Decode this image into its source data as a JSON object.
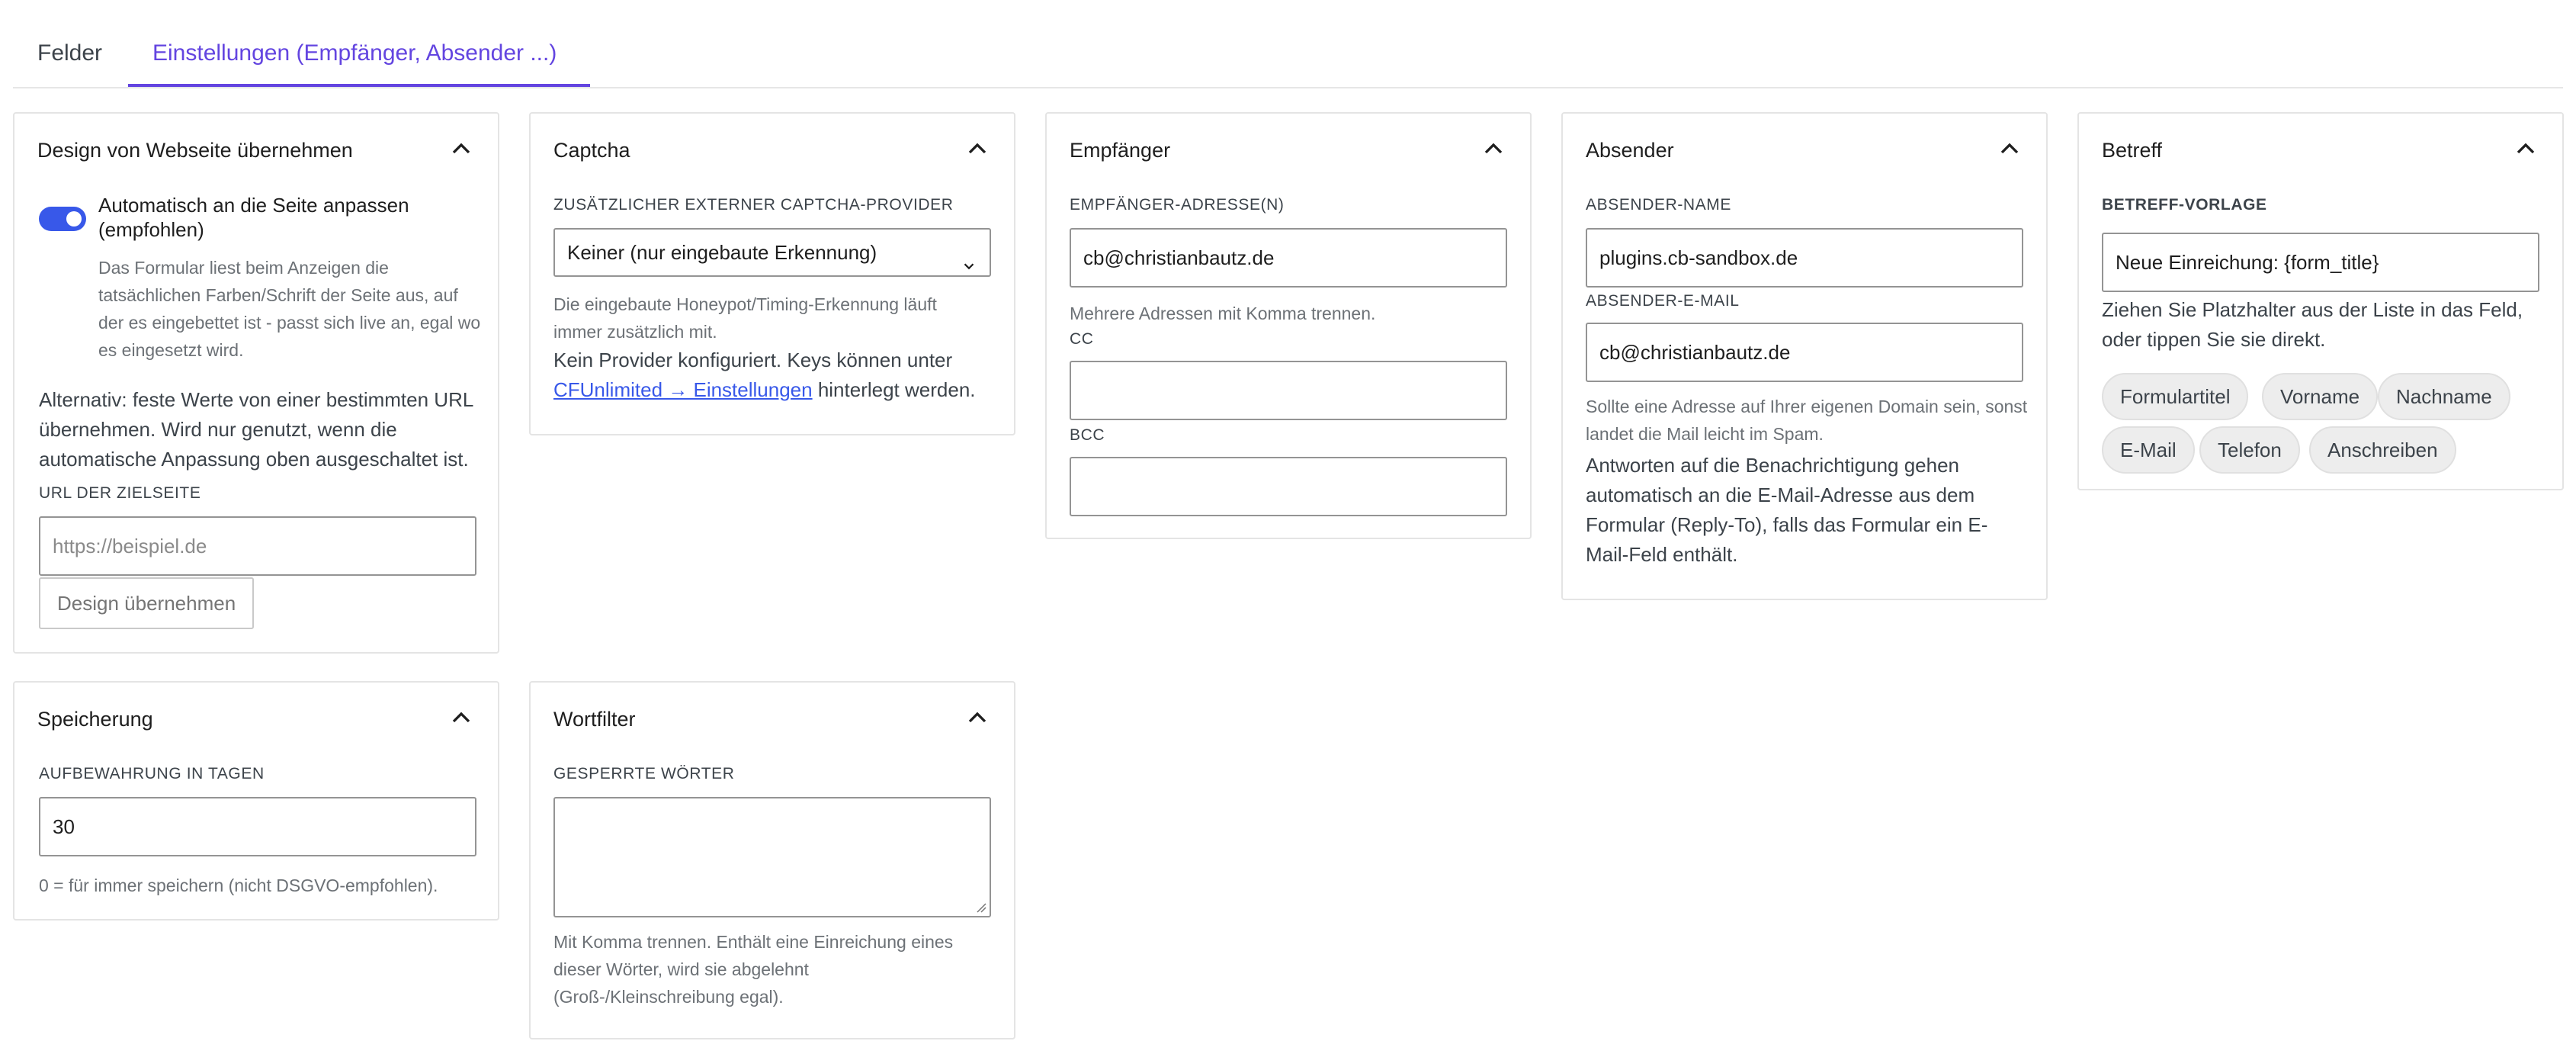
{
  "tabs": [
    {
      "label": "Felder"
    },
    {
      "label": "Einstellungen (Empfänger, Absender ...)"
    }
  ],
  "design": {
    "title": "Design von Webseite übernehmen",
    "toggle_label": "Automatisch an die Seite anpassen (empfohlen)",
    "toggle_on": true,
    "toggle_help": "Das Formular liest beim Anzeigen die tatsächlichen Farben/Schrift der Seite aus, auf der es eingebettet ist - passt sich live an, egal wo es eingesetzt wird.",
    "alt_text": "Alternativ: feste Werte von einer bestimmten URL übernehmen. Wird nur genutzt, wenn die automatische Anpassung oben ausgeschaltet ist.",
    "url_label": "URL der Zielseite",
    "url_placeholder": "https://beispiel.de",
    "button_label": "Design übernehmen"
  },
  "captcha": {
    "title": "Captcha",
    "provider_label": "Zusätzlicher externer Captcha-Provider",
    "provider_value": "Keiner (nur eingebaute Erkennung)",
    "help": "Die eingebaute Honeypot/Timing-Erkennung läuft immer zusätzlich mit.",
    "note_prefix": "Kein Provider konfiguriert. Keys können unter ",
    "note_link": "CFUnlimited → Einstellungen",
    "note_suffix": " hinterlegt werden."
  },
  "recipient": {
    "title": "Empfänger",
    "address_label": "Empfänger-Adresse(n)",
    "address_value": "cb@christianbautz.de",
    "address_help": "Mehrere Adressen mit Komma trennen.",
    "cc_label": "CC",
    "cc_value": "",
    "bcc_label": "BCC",
    "bcc_value": ""
  },
  "sender": {
    "title": "Absender",
    "name_label": "Absender-Name",
    "name_value": "plugins.cb-sandbox.de",
    "email_label": "Absender-E-Mail",
    "email_value": "cb@christianbautz.de",
    "email_help": "Sollte eine Adresse auf Ihrer eigenen Domain sein, sonst landet die Mail leicht im Spam.",
    "reply_note": "Antworten auf die Benachrichtigung gehen automatisch an die E-Mail-Adresse aus dem Formular (Reply-To), falls das Formular ein E-Mail-Feld enthält."
  },
  "subject": {
    "title": "Betreff",
    "template_label": "Betreff-Vorlage",
    "template_value": "Neue Einreichung: {form_title}",
    "help": "Ziehen Sie Platzhalter aus der Liste in das Feld, oder tippen Sie sie direkt.",
    "chips": [
      "Formulartitel",
      "Vorname",
      "Nachname",
      "E-Mail",
      "Telefon",
      "Anschreiben"
    ]
  },
  "storage": {
    "title": "Speicherung",
    "retention_label": "Aufbewahrung in Tagen",
    "retention_value": "30",
    "help": "0 = für immer speichern (nicht DSGVO-empfohlen)."
  },
  "wordfilter": {
    "title": "Wortfilter",
    "blocked_label": "Gesperrte Wörter",
    "blocked_value": "",
    "help": "Mit Komma trennen. Enthält eine Einreichung eines dieser Wörter, wird sie abgelehnt (Groß-/Kleinschreibung egal)."
  },
  "colors": {
    "accent": "#6345e0",
    "toggle": "#3858e9",
    "link": "#3858e9"
  }
}
